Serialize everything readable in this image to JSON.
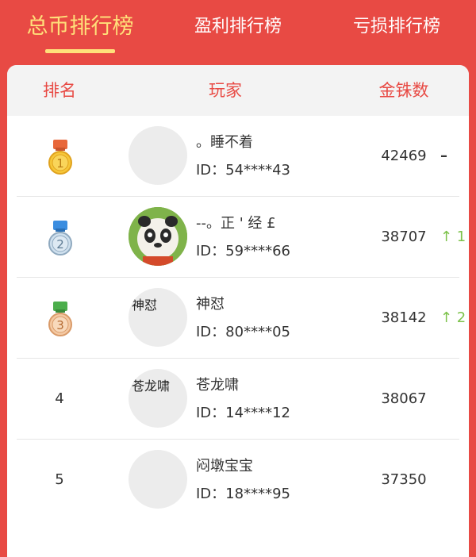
{
  "tabs": [
    {
      "label": "总币排行榜",
      "active": true
    },
    {
      "label": "盈利排行榜",
      "active": false
    },
    {
      "label": "亏损排行榜",
      "active": false
    }
  ],
  "table": {
    "headers": {
      "rank": "排名",
      "player": "玩家",
      "coins": "金铢数"
    },
    "rows": [
      {
        "rank": "1",
        "medal": "gold",
        "name": "。睡不着",
        "id": "ID：54****43",
        "coins": "42469",
        "change": "–",
        "avatar_text": ""
      },
      {
        "rank": "2",
        "medal": "silver",
        "name": "--。正 ' 经 £",
        "id": "ID：59****66",
        "coins": "38707",
        "change": "↑ 1",
        "avatar_text": ""
      },
      {
        "rank": "3",
        "medal": "bronze",
        "name": "神怼",
        "id": "ID：80****05",
        "coins": "38142",
        "change": "↑ 2",
        "avatar_text": "神怼"
      },
      {
        "rank": "4",
        "medal": "",
        "name": "苍龙啸",
        "id": "ID：14****12",
        "coins": "38067",
        "change": "",
        "avatar_text": "苍龙啸"
      },
      {
        "rank": "5",
        "medal": "",
        "name": "闷墩宝宝",
        "id": "ID：18****95",
        "coins": "37350",
        "change": "",
        "avatar_text": ""
      }
    ]
  },
  "colors": {
    "brand": "#e84a44",
    "accent": "#ffe07a",
    "up": "#7cc24a"
  }
}
